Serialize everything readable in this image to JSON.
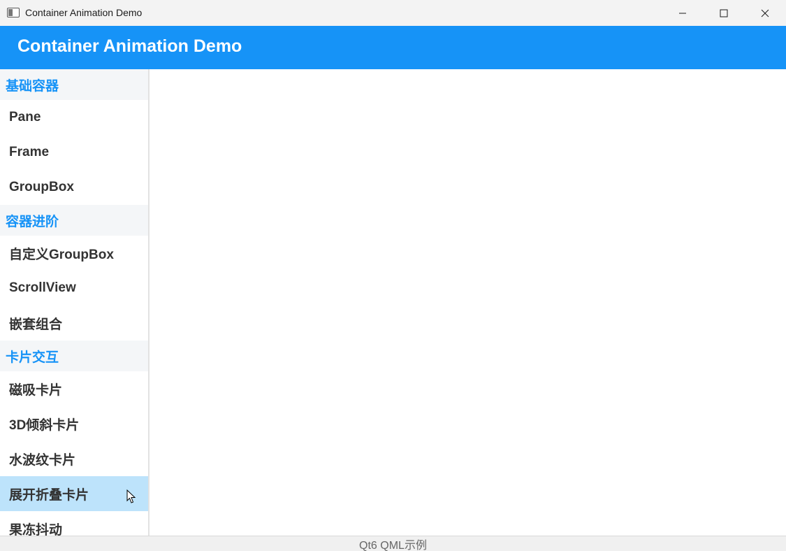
{
  "window": {
    "title": "Container Animation Demo",
    "controls": [
      "minimize-icon",
      "maximize-icon",
      "close-icon"
    ]
  },
  "header": {
    "title": "Container Animation Demo",
    "background": "#1693f7"
  },
  "sidebar": {
    "sections": [
      {
        "title": "基础容器",
        "items": [
          "Pane",
          "Frame",
          "GroupBox"
        ]
      },
      {
        "title": "容器进阶",
        "items": [
          "自定义GroupBox",
          "ScrollView",
          "嵌套组合"
        ]
      },
      {
        "title": "卡片交互",
        "items": [
          "磁吸卡片",
          "3D倾斜卡片",
          "水波纹卡片",
          "展开折叠卡片",
          "果冻抖动"
        ]
      }
    ],
    "hovered_item": "展开折叠卡片",
    "section_color": "#1693f7",
    "hover_color": "#bde3fb"
  },
  "footer": {
    "text": "Qt6 QML示例"
  }
}
